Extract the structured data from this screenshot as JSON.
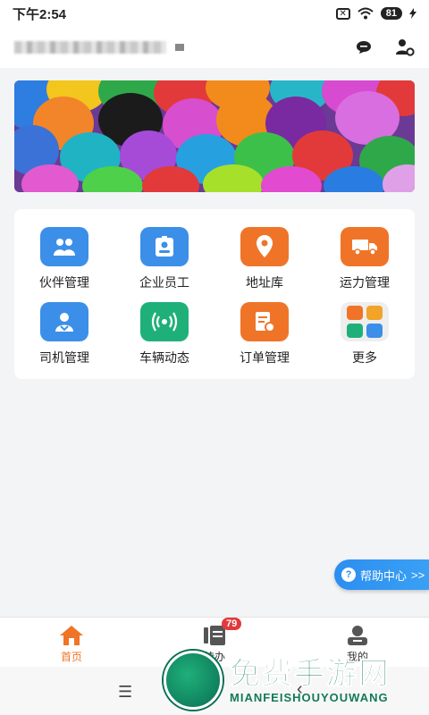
{
  "status_bar": {
    "time": "下午2:54",
    "sim": "✕",
    "battery": "81"
  },
  "header": {
    "chat_icon": "chat-bubble-icon",
    "user_icon": "user-settings-icon"
  },
  "banner": {
    "image": "balloons"
  },
  "grid": [
    {
      "label": "伙伴管理",
      "icon": "partners-icon",
      "color": "#3b8fe8"
    },
    {
      "label": "企业员工",
      "icon": "employee-badge-icon",
      "color": "#3b8fe8"
    },
    {
      "label": "地址库",
      "icon": "location-pin-icon",
      "color": "#f07428"
    },
    {
      "label": "运力管理",
      "icon": "truck-icon",
      "color": "#f07428"
    },
    {
      "label": "司机管理",
      "icon": "driver-icon",
      "color": "#3b8fe8"
    },
    {
      "label": "车辆动态",
      "icon": "signal-icon",
      "color": "#1fb07a"
    },
    {
      "label": "订单管理",
      "icon": "order-icon",
      "color": "#f07428"
    },
    {
      "label": "更多",
      "icon": "more-grid-icon",
      "color": "#e6e6e6"
    }
  ],
  "help": {
    "label": "帮助中心",
    "suffix": ">>"
  },
  "tabs": [
    {
      "label": "首页",
      "active": true
    },
    {
      "label": "待办",
      "badge": "79"
    },
    {
      "label": "我的"
    }
  ],
  "watermark": {
    "title": "免费手游网",
    "subtitle": "MIANFEISHOUYOUWANG"
  }
}
